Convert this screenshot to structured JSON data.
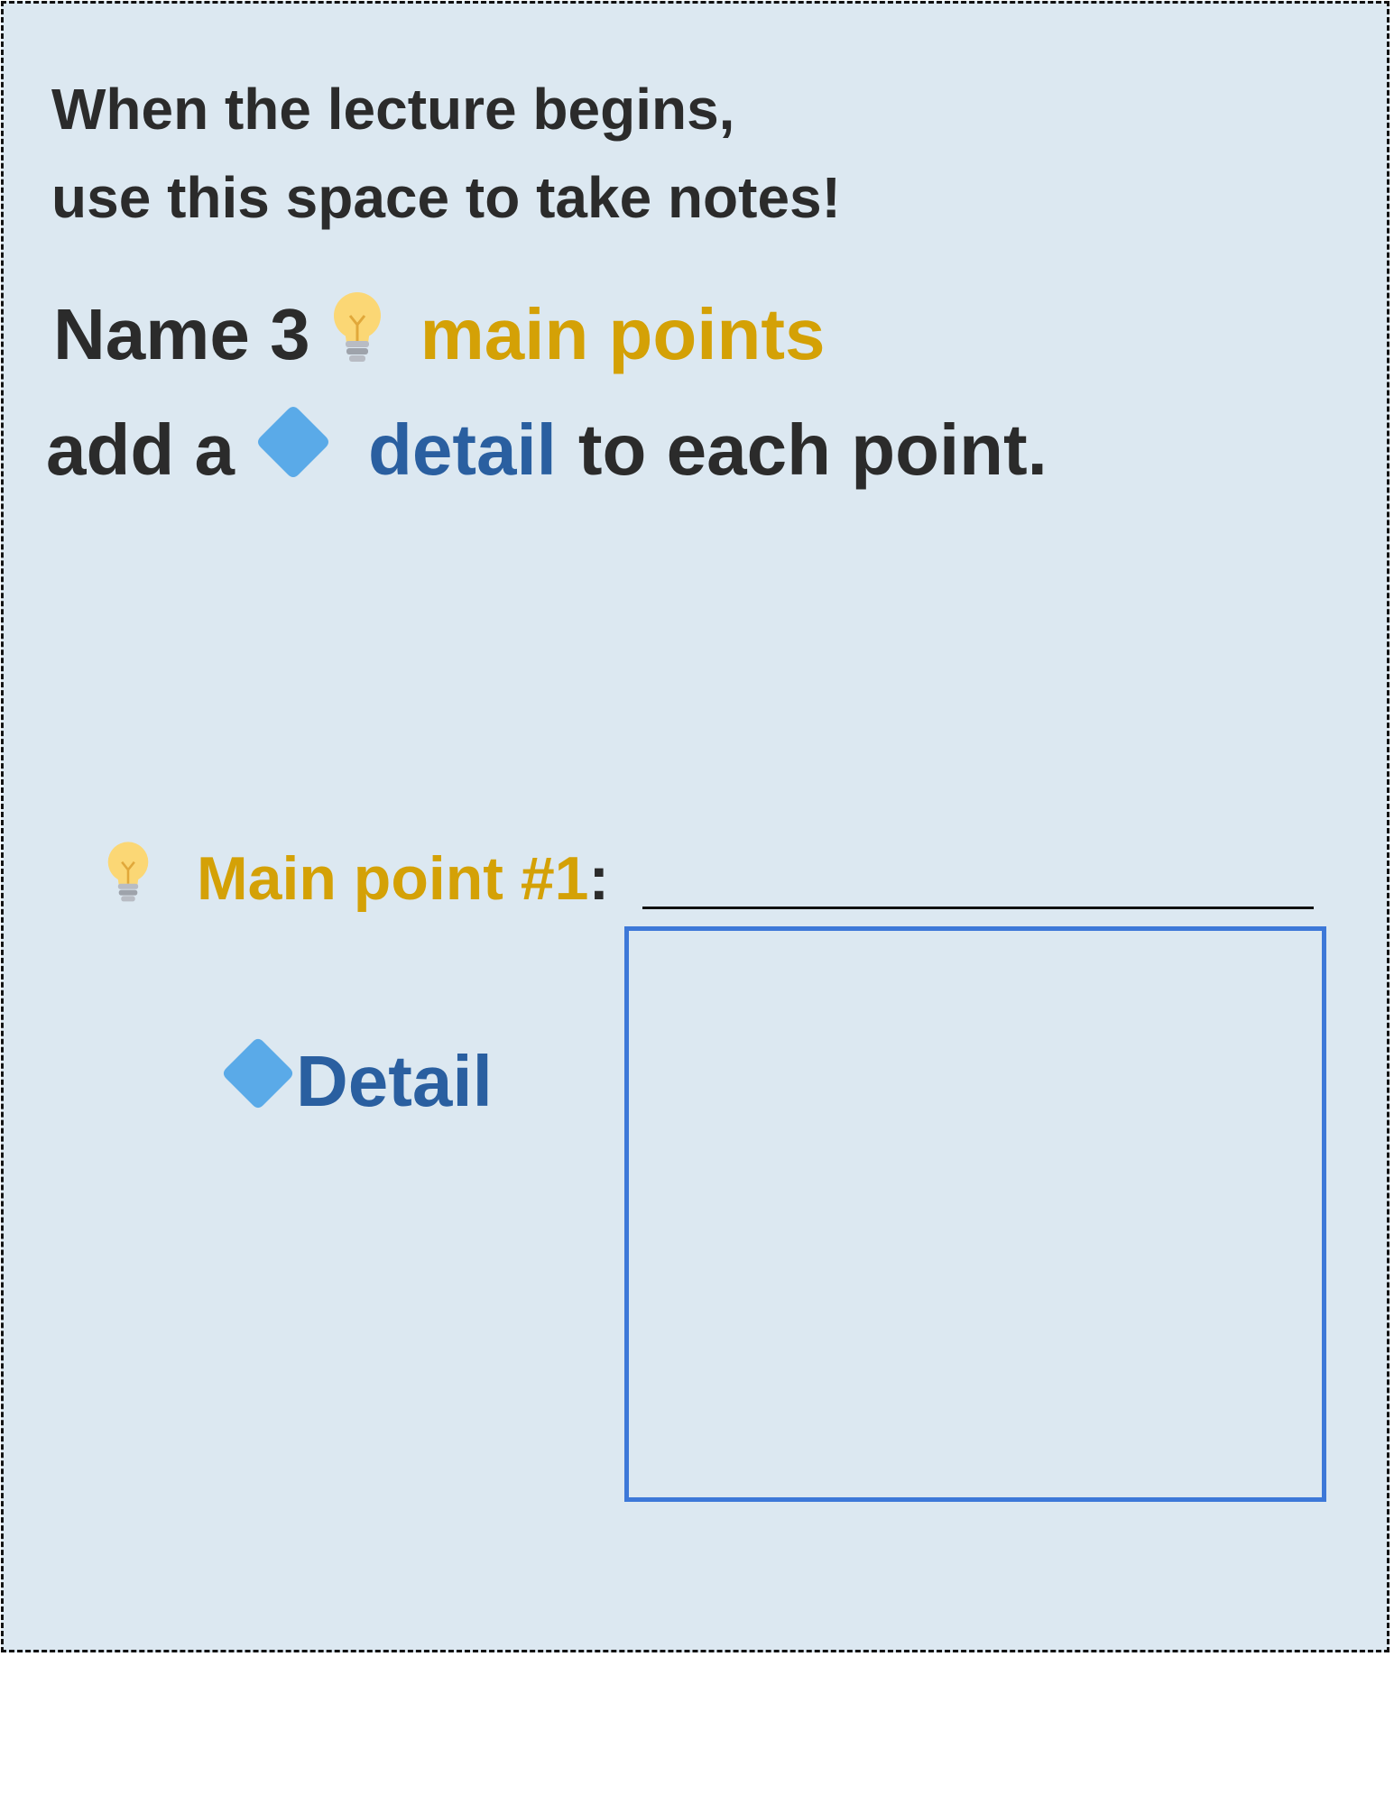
{
  "intro": {
    "line1": "When the lecture begins,",
    "line2": "use this space to take notes!"
  },
  "instructions": {
    "line1_prefix": "Name 3",
    "line1_highlight": "main points",
    "line2_prefix": "add a",
    "line2_highlight": "detail",
    "line2_suffix": "to each point."
  },
  "main_point": {
    "label": "Main point #1",
    "colon": ":"
  },
  "detail": {
    "label": "Detail"
  },
  "icons": {
    "main_point": "light-bulb-icon",
    "detail": "blue-diamond-icon"
  },
  "colors": {
    "background": "#dce8f1",
    "main_point_text": "#d4a106",
    "detail_text": "#2a5fa0",
    "detail_box_border": "#3d78d8",
    "diamond": "#5aaae8"
  }
}
